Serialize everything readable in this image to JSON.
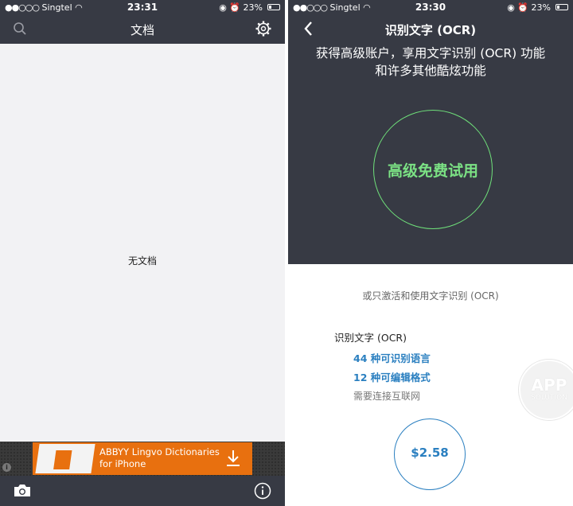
{
  "left_screen": {
    "status_bar": {
      "carrier": "Singtel",
      "time": "23:31",
      "battery": "23%"
    },
    "nav": {
      "title": "文档",
      "search_icon": "search-icon",
      "settings_icon": "gear-icon"
    },
    "empty_message": "无文档",
    "ad": {
      "line1": "ABBYY Lingvo Dictionaries",
      "line2": "for iPhone",
      "info_glyph": "i",
      "download_icon": "download-arrow-icon"
    },
    "toolbar": {
      "camera_icon": "camera-icon",
      "info_icon": "info-circle-icon"
    }
  },
  "right_screen": {
    "status_bar": {
      "carrier": "Singtel",
      "time": "23:30",
      "battery": "23%"
    },
    "nav": {
      "title": "识别文字 (OCR)",
      "back_icon": "chevron-left-icon"
    },
    "promo": {
      "line1": "获得高级账户，享用文字识别 (OCR) 功能",
      "line2": "和许多其他酷炫功能"
    },
    "trial_button": "高级免费试用",
    "alternative_text": "或只激活和使用文字识别 (OCR)",
    "product": {
      "name": "识别文字 (OCR)",
      "features": [
        "44 种可识别语言",
        "12 种可编辑格式"
      ],
      "note": "需要连接互联网"
    },
    "price": "$2.58"
  },
  "watermark": {
    "line1": "APP",
    "line2": "SOLUTION"
  },
  "colors": {
    "nav_dark": "#373a44",
    "accent_green": "#7be184",
    "accent_blue": "#2a7fc0",
    "ad_orange": "#e8700f"
  }
}
